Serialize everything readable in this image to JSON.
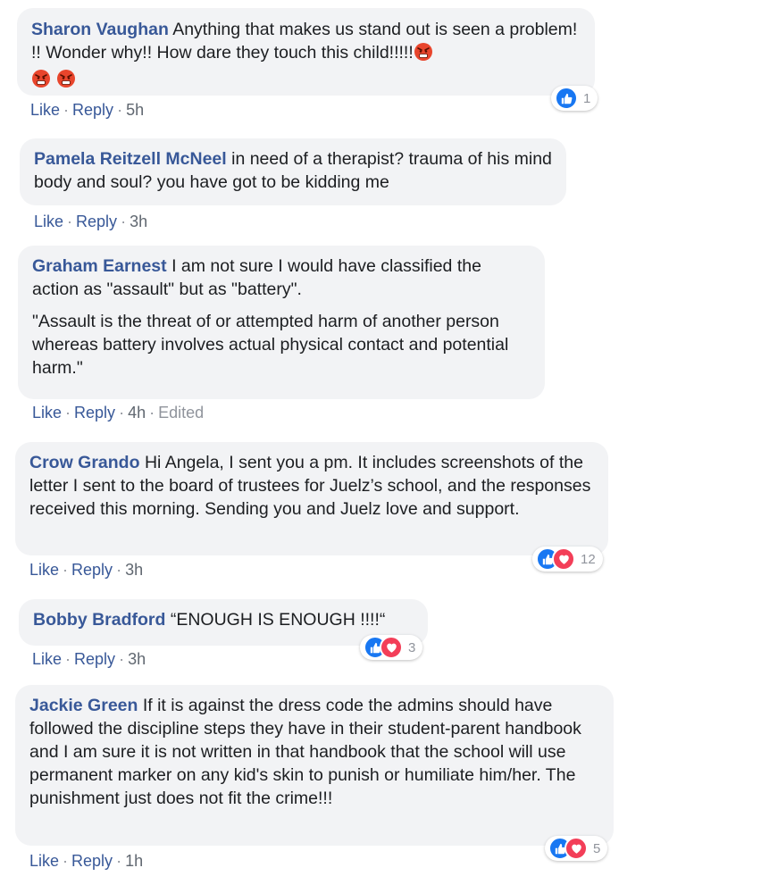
{
  "colors": {
    "author": "#385898",
    "bubble": "#f2f3f5",
    "meta": "#606770",
    "like": "#1877f2",
    "love": "#f33e58"
  },
  "actions": {
    "like": "Like",
    "reply": "Reply",
    "separator": "·"
  },
  "comments": [
    {
      "author": "Sharon Vaughan",
      "paragraphs": [
        "Anything that makes us stand out is seen a problem! !! Wonder why!! How dare they touch this child!!!!!"
      ],
      "emoji": [
        "pouting-face-icon",
        "pouting-face-icon",
        "pouting-face-icon"
      ],
      "time": "5h",
      "reactions": {
        "types": [
          "like"
        ],
        "count": "1"
      }
    },
    {
      "author": "Pamela Reitzell McNeel",
      "paragraphs": [
        "in need of a therapist? trauma of his mind body and soul? you have got to be kidding me"
      ],
      "time": "3h"
    },
    {
      "author": "Graham Earnest",
      "paragraphs": [
        "I am not sure I would have classified the action as \"assault\" but as \"battery\".",
        "\"Assault is the threat of or attempted harm of another person whereas battery involves actual physical contact and potential harm.\""
      ],
      "time": "4h",
      "edited": "Edited"
    },
    {
      "author": "Crow Grando",
      "paragraphs": [
        "Hi Angela, I sent you a pm. It includes screenshots of the letter I sent to the board of trustees for Juelz’s school, and the responses received this morning. Sending you and Juelz love and support."
      ],
      "time": "3h",
      "reactions": {
        "types": [
          "like",
          "love"
        ],
        "count": "12"
      }
    },
    {
      "author": "Bobby Bradford",
      "paragraphs": [
        "“ENOUGH IS ENOUGH !!!!“"
      ],
      "time": "3h",
      "reactions": {
        "types": [
          "like",
          "love"
        ],
        "count": "3"
      }
    },
    {
      "author": "Jackie Green",
      "paragraphs": [
        "If it is against the dress code the admins should have followed the discipline steps they have in their student-parent handbook and I am sure it is not written in that handbook that the school will use permanent marker on any kid's skin to punish or humiliate him/her. The punishment just does not fit the crime!!!"
      ],
      "time": "1h",
      "reactions": {
        "types": [
          "like",
          "love"
        ],
        "count": "5"
      }
    }
  ]
}
